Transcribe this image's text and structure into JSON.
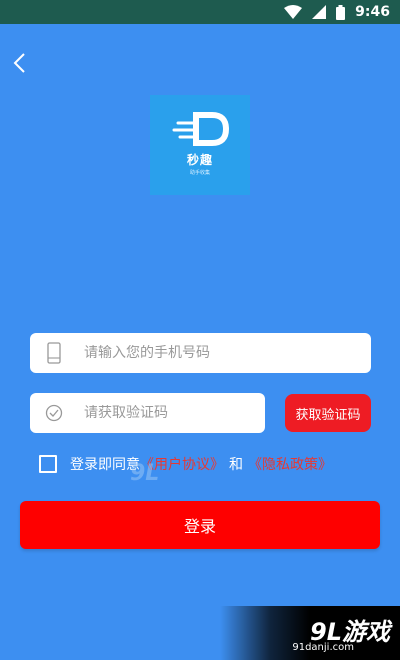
{
  "status_bar": {
    "time": "9:46"
  },
  "logo": {
    "chinese_text": "秒趣",
    "sub_text": "助手收集"
  },
  "phone_field": {
    "placeholder": "请输入您的手机号码"
  },
  "code_field": {
    "placeholder": "请获取验证码"
  },
  "get_code_button": {
    "label": "获取验证码"
  },
  "agreement": {
    "prefix": "登录即同意",
    "user_agreement": "《用户协议》",
    "and": "和",
    "privacy_policy": "《隐私政策》"
  },
  "login_button": {
    "label": "登录"
  },
  "watermark": {
    "logo_text": "9L游戏",
    "url": "91danji.com"
  },
  "colors": {
    "background": "#3d8ff1",
    "status_bar": "#1e5b4f",
    "primary_red": "#fe0000",
    "link_red": "#e53935",
    "logo_bg": "#2aa0ec"
  },
  "icons": {
    "back": "chevron-left-icon",
    "phone": "phone-icon",
    "code": "check-circle-icon",
    "wifi": "wifi-icon",
    "signal": "signal-icon",
    "battery": "battery-icon"
  }
}
